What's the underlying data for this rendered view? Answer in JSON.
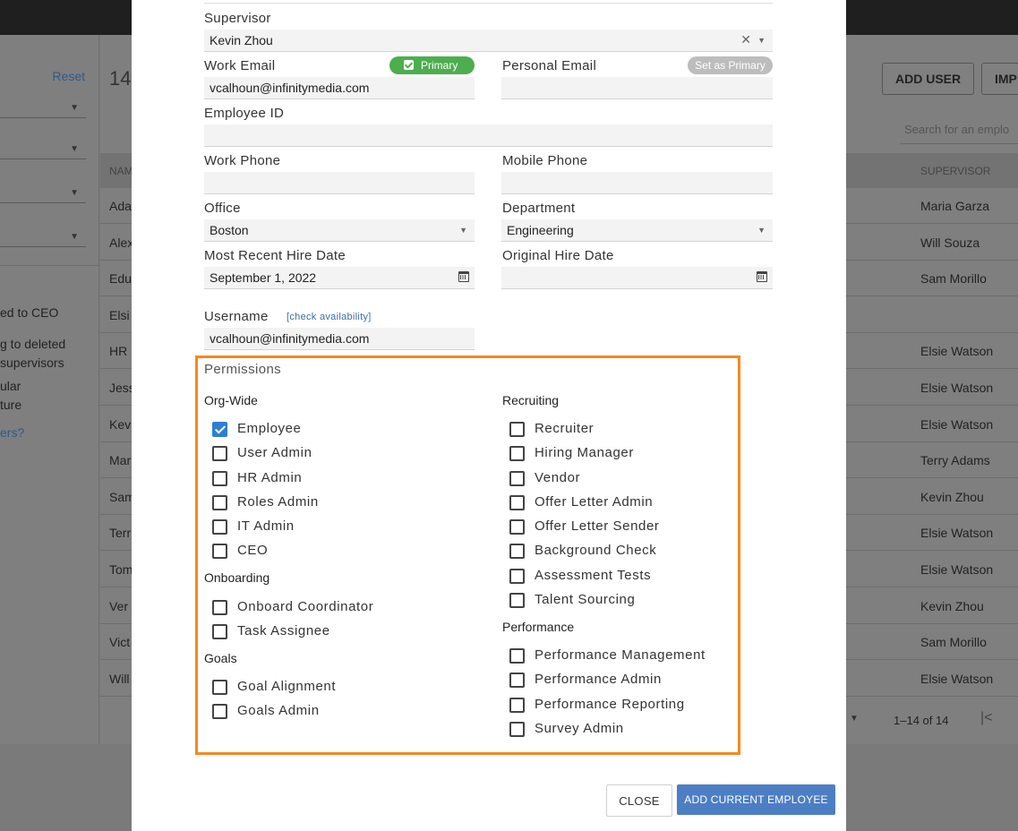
{
  "background": {
    "sidebar": {
      "reset": "Reset",
      "texts": [
        "ed to CEO",
        "g to deleted",
        "supervisors",
        "ular",
        "ture"
      ],
      "link": "ers?"
    },
    "count": "14",
    "buttons": {
      "add_user": "ADD USER",
      "import": "IMP"
    },
    "search_placeholder": "Search for an emplo",
    "columns": {
      "name": "NAM",
      "supervisor": "SUPERVISOR"
    },
    "rows": [
      {
        "name": "Ada",
        "supervisor": "Maria Garza"
      },
      {
        "name": "Alex",
        "supervisor": "Will Souza"
      },
      {
        "name": "Edu",
        "supervisor": "Sam Morillo"
      },
      {
        "name": "Elsi",
        "supervisor": ""
      },
      {
        "name": "HR",
        "supervisor": "Elsie Watson"
      },
      {
        "name": "Jess",
        "supervisor": "Elsie Watson"
      },
      {
        "name": "Kev",
        "supervisor": "Elsie Watson"
      },
      {
        "name": "Mar",
        "supervisor": "Terry Adams"
      },
      {
        "name": "Sam",
        "supervisor": "Kevin Zhou"
      },
      {
        "name": "Terr",
        "supervisor": "Elsie Watson"
      },
      {
        "name": "Tom",
        "supervisor": "Elsie Watson"
      },
      {
        "name": "Ver",
        "supervisor": "Kevin Zhou"
      },
      {
        "name": "Vict",
        "supervisor": "Sam Morillo"
      },
      {
        "name": "Will",
        "supervisor": "Elsie Watson"
      }
    ],
    "pagination": "1–14 of 14"
  },
  "form": {
    "supervisor": {
      "label": "Supervisor",
      "value": "Kevin Zhou"
    },
    "work_email": {
      "label": "Work Email",
      "value": "vcalhoun@infinitymedia.com",
      "badge": "Primary"
    },
    "personal_email": {
      "label": "Personal Email",
      "value": "",
      "badge": "Set as Primary"
    },
    "employee_id": {
      "label": "Employee ID",
      "value": ""
    },
    "work_phone": {
      "label": "Work Phone",
      "value": ""
    },
    "mobile_phone": {
      "label": "Mobile Phone",
      "value": ""
    },
    "office": {
      "label": "Office",
      "value": "Boston"
    },
    "department": {
      "label": "Department",
      "value": "Engineering"
    },
    "recent_hire": {
      "label": "Most Recent Hire Date",
      "value": "September 1, 2022"
    },
    "original_hire": {
      "label": "Original Hire Date",
      "value": ""
    },
    "username": {
      "label": "Username",
      "link": "[check availability]",
      "value": "vcalhoun@infinitymedia.com"
    }
  },
  "permissions": {
    "title": "Permissions",
    "groups": {
      "org_wide": {
        "label": "Org-Wide",
        "items": [
          {
            "label": "Employee",
            "checked": true
          },
          {
            "label": "User Admin",
            "checked": false
          },
          {
            "label": "HR Admin",
            "checked": false
          },
          {
            "label": "Roles Admin",
            "checked": false
          },
          {
            "label": "IT Admin",
            "checked": false
          },
          {
            "label": "CEO",
            "checked": false
          }
        ]
      },
      "onboarding": {
        "label": "Onboarding",
        "items": [
          {
            "label": "Onboard Coordinator",
            "checked": false
          },
          {
            "label": "Task Assignee",
            "checked": false
          }
        ]
      },
      "goals": {
        "label": "Goals",
        "items": [
          {
            "label": "Goal Alignment",
            "checked": false
          },
          {
            "label": "Goals Admin",
            "checked": false
          }
        ]
      },
      "recruiting": {
        "label": "Recruiting",
        "items": [
          {
            "label": "Recruiter",
            "checked": false
          },
          {
            "label": "Hiring Manager",
            "checked": false
          },
          {
            "label": "Vendor",
            "checked": false
          },
          {
            "label": "Offer Letter Admin",
            "checked": false
          },
          {
            "label": "Offer Letter Sender",
            "checked": false
          },
          {
            "label": "Background Check",
            "checked": false
          },
          {
            "label": "Assessment Tests",
            "checked": false
          },
          {
            "label": "Talent Sourcing",
            "checked": false
          }
        ]
      },
      "performance": {
        "label": "Performance",
        "items": [
          {
            "label": "Performance Management",
            "checked": false
          },
          {
            "label": "Performance Admin",
            "checked": false
          },
          {
            "label": "Performance Reporting",
            "checked": false
          },
          {
            "label": "Survey Admin",
            "checked": false
          }
        ]
      }
    }
  },
  "actions": {
    "close": "CLOSE",
    "add": "ADD CURRENT EMPLOYEE"
  },
  "colors": {
    "accent": "#4c7ec4",
    "highlight": "#f5891f",
    "primary_badge": "#4cae4f",
    "checkbox_on": "#2e7ed1"
  }
}
